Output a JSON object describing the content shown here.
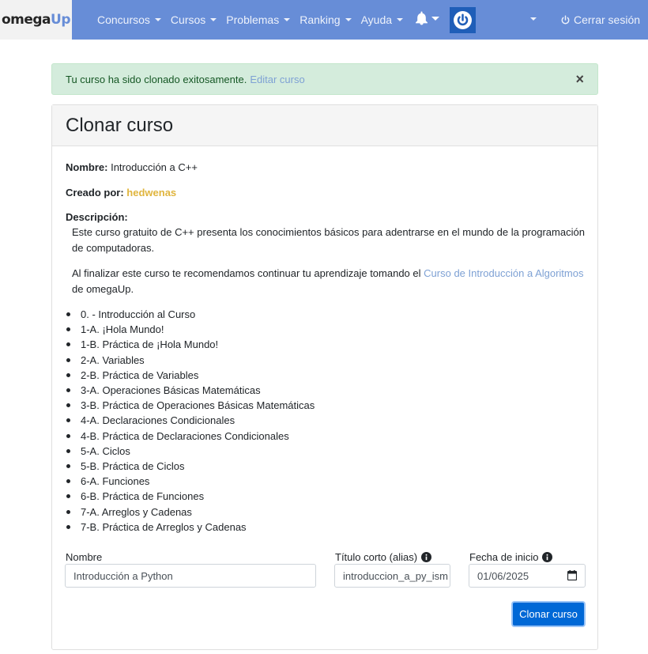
{
  "brand": {
    "omega": "omega",
    "up": "Up"
  },
  "nav": {
    "items": [
      {
        "label": "Concursos"
      },
      {
        "label": "Cursos"
      },
      {
        "label": "Problemas"
      },
      {
        "label": "Ranking"
      },
      {
        "label": "Ayuda"
      }
    ],
    "logout_label": "Cerrar sesión"
  },
  "alert": {
    "message": "Tu curso ha sido clonado exitosamente.",
    "link_label": "Editar curso",
    "close_symbol": "×"
  },
  "card": {
    "title": "Clonar curso",
    "name_label": "Nombre:",
    "name_value": "Introducción a C++",
    "creator_label": "Creado por:",
    "creator_value": "hedwenas",
    "description_label": "Descripción:",
    "description_p1": "Este curso gratuito de C++ presenta los conocimientos básicos para adentrarse en el mundo de la programación de computadoras.",
    "description_p2_before": "Al finalizar este curso te recomendamos continuar tu aprendizaje tomando el",
    "description_p2_link": "Curso de Introducción a Algoritmos",
    "description_p2_after": "de omegaUp."
  },
  "syllabus": [
    "0. - Introducción al Curso",
    "1-A. ¡Hola Mundo!",
    "1-B. Práctica de ¡Hola Mundo!",
    "2-A. Variables",
    "2-B. Práctica de Variables",
    "3-A. Operaciones Básicas Matemáticas",
    "3-B. Práctica de Operaciones Básicas Matemáticas",
    "4-A. Declaraciones Condicionales",
    "4-B. Práctica de Declaraciones Condicionales",
    "5-A. Ciclos",
    "5-B. Práctica de Ciclos",
    "6-A. Funciones",
    "6-B. Práctica de Funciones",
    "7-A. Arreglos y Cadenas",
    "7-B. Práctica de Arreglos y Cadenas"
  ],
  "form": {
    "name_label": "Nombre",
    "name_value": "Introducción a Python",
    "alias_label": "Título corto (alias)",
    "alias_value": "introduccion_a_py_ism",
    "start_label": "Fecha de inicio",
    "start_value": "01/06/2025",
    "submit_label": "Clonar curso"
  },
  "colors": {
    "navbar": "#678dd7",
    "link": "#7ea1d4",
    "creator": "#e0b53e",
    "button": "#0068d6",
    "alert_bg": "#d4ecdc"
  },
  "icons": {
    "notifications": "bell-icon",
    "avatar": "power-icon",
    "logout": "power-icon",
    "info": "info-icon",
    "calendar": "calendar-icon"
  }
}
